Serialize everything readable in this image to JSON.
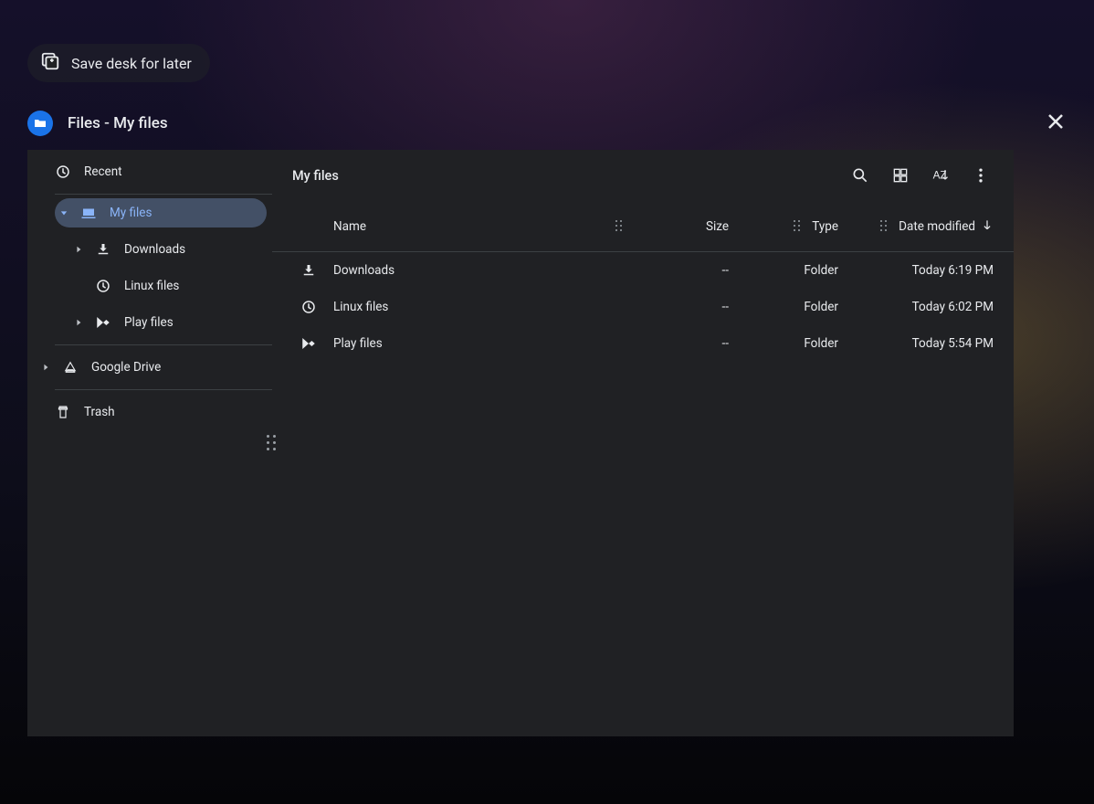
{
  "save_desk_label": "Save desk for later",
  "window_title": "Files - My files",
  "sidebar": {
    "recent": "Recent",
    "my_files": "My files",
    "downloads": "Downloads",
    "linux_files": "Linux files",
    "play_files": "Play files",
    "google_drive": "Google Drive",
    "trash": "Trash"
  },
  "toolbar": {
    "heading": "My files"
  },
  "columns": {
    "name": "Name",
    "size": "Size",
    "type": "Type",
    "date": "Date modified"
  },
  "rows": [
    {
      "name": "Downloads",
      "size": "--",
      "type": "Folder",
      "date": "Today 6:19 PM",
      "icon": "download"
    },
    {
      "name": "Linux files",
      "size": "--",
      "type": "Folder",
      "date": "Today 6:02 PM",
      "icon": "linux"
    },
    {
      "name": "Play files",
      "size": "--",
      "type": "Folder",
      "date": "Today 5:54 PM",
      "icon": "play"
    }
  ]
}
